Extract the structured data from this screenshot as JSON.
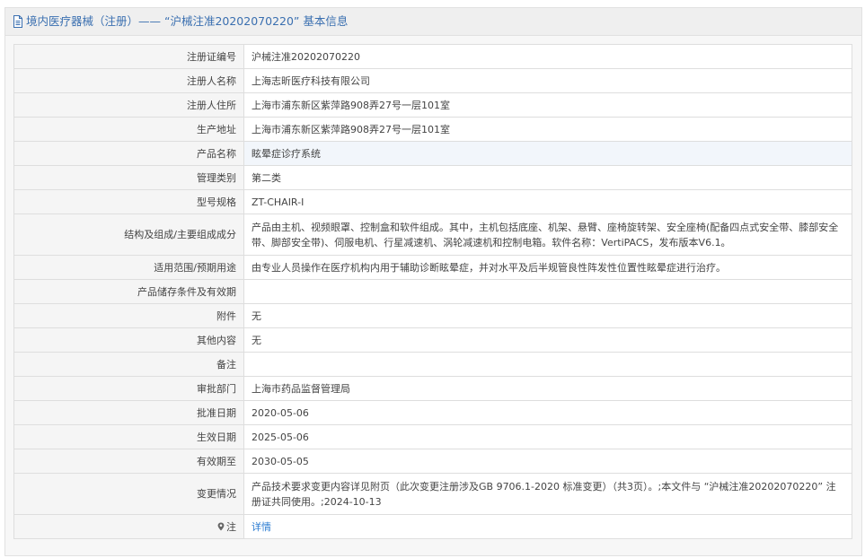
{
  "header": {
    "title": "境内医疗器械（注册）——  “沪械注准20202070220” 基本信息"
  },
  "rows": [
    {
      "label": "注册证编号",
      "value": "沪械注准20202070220"
    },
    {
      "label": "注册人名称",
      "value": "上海志昕医疗科技有限公司"
    },
    {
      "label": "注册人住所",
      "value": "上海市浦东新区紫萍路908弄27号一层101室"
    },
    {
      "label": "生产地址",
      "value": "上海市浦东新区紫萍路908弄27号一层101室"
    },
    {
      "label": "产品名称",
      "value": "眩晕症诊疗系统"
    },
    {
      "label": "管理类别",
      "value": "第二类"
    },
    {
      "label": "型号规格",
      "value": "ZT-CHAIR-I"
    },
    {
      "label": "结构及组成/主要组成成分",
      "value": "产品由主机、视频眼罩、控制盒和软件组成。其中，主机包括底座、机架、悬臂、座椅旋转架、安全座椅(配备四点式安全带、膝部安全带、脚部安全带)、伺服电机、行星减速机、涡轮减速机和控制电箱。软件名称：VertiPACS，发布版本V6.1。"
    },
    {
      "label": "适用范围/预期用途",
      "value": "由专业人员操作在医疗机构内用于辅助诊断眩晕症，并对水平及后半规管良性阵发性位置性眩晕症进行治疗。"
    },
    {
      "label": "产品储存条件及有效期",
      "value": ""
    },
    {
      "label": "附件",
      "value": "无"
    },
    {
      "label": "其他内容",
      "value": "无"
    },
    {
      "label": "备注",
      "value": ""
    },
    {
      "label": "审批部门",
      "value": "上海市药品监督管理局"
    },
    {
      "label": "批准日期",
      "value": "2020-05-06"
    },
    {
      "label": "生效日期",
      "value": "2025-05-06"
    },
    {
      "label": "有效期至",
      "value": "2030-05-05"
    },
    {
      "label": "变更情况",
      "value": "产品技术要求变更内容详见附页（此次变更注册涉及GB 9706.1-2020 标准变更）（共3页）。;本文件与 “沪械注准20202070220” 注册证共同使用。;2024-10-13"
    }
  ],
  "note": {
    "label": "注",
    "link": "详情",
    "icon": "location-pin-icon"
  },
  "colors": {
    "header_text": "#3a6fb0",
    "link": "#2a7bd1",
    "label_bg": "#f5f5f5",
    "highlight_row": "#f2f6fb"
  }
}
